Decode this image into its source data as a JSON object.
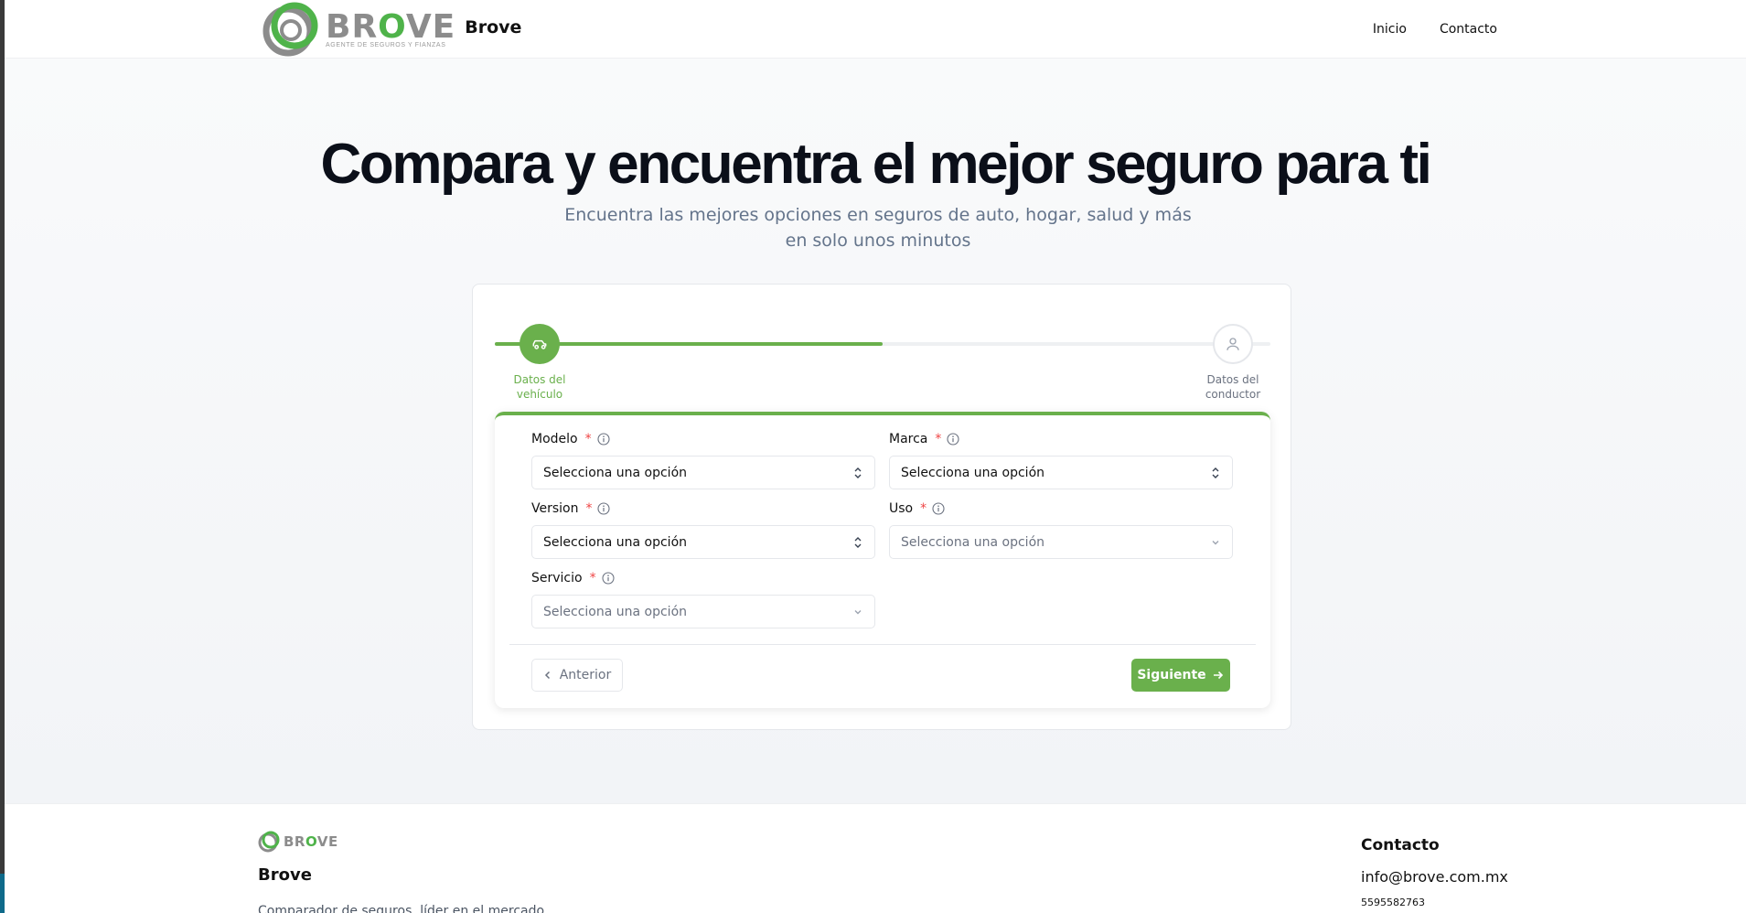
{
  "colors": {
    "accent": "#6ab04c",
    "logo_green": "#4fb34a",
    "logo_gray": "#8c8c8c",
    "required": "#ef4444",
    "muted_text": "#64748b"
  },
  "header": {
    "logo_word_prefix": "BR",
    "logo_word_o": "O",
    "logo_word_suffix": "VE",
    "logo_tagline": "AGENTE DE SEGUROS Y FIANZAS",
    "brand_name": "Brove",
    "nav": [
      {
        "label": "Inicio"
      },
      {
        "label": "Contacto"
      }
    ]
  },
  "hero": {
    "title": "Compara y encuentra el mejor seguro para ti",
    "subtitle": "Encuentra las mejores opciones en seguros de auto, hogar, salud y más en solo unos minutos"
  },
  "stepper": {
    "progress_percent": 50,
    "steps": [
      {
        "label": "Datos del vehículo",
        "icon": "car-icon",
        "state": "active"
      },
      {
        "label": "Datos del conductor",
        "icon": "user-icon",
        "state": "pending"
      }
    ]
  },
  "form": {
    "fields": {
      "modelo": {
        "label": "Modelo",
        "required_mark": "*",
        "value": "Selecciona una opción"
      },
      "marca": {
        "label": "Marca",
        "required_mark": "*",
        "value": "Selecciona una opción"
      },
      "version": {
        "label": "Version",
        "required_mark": "*",
        "value": "Selecciona una opción"
      },
      "uso": {
        "label": "Uso",
        "required_mark": "*",
        "placeholder": "Selecciona una opción"
      },
      "servicio": {
        "label": "Servicio",
        "required_mark": "*",
        "placeholder": "Selecciona una opción"
      }
    },
    "prev_label": "Anterior",
    "next_label": "Siguiente"
  },
  "footer": {
    "logo_word_prefix": "BR",
    "logo_word_o": "O",
    "logo_word_suffix": "VE",
    "brand_name": "Brove",
    "description": "Comparador de seguros, líder en el mercado",
    "contact_title": "Contacto",
    "email": "info@brove.com.mx",
    "phone": "5595582763"
  }
}
